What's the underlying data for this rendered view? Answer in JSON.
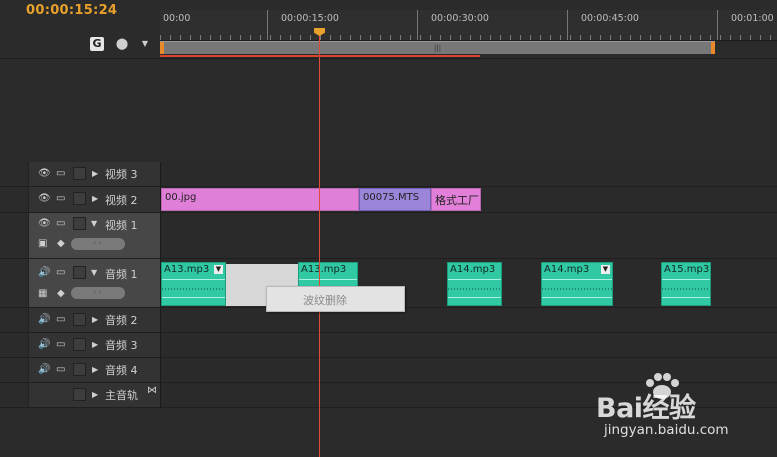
{
  "header": {
    "timecode": "00:00:15:24"
  },
  "ruler": {
    "labels": [
      "00:00",
      "00:00:15:00",
      "00:00:30:00",
      "00:00:45:00",
      "00:01:00"
    ]
  },
  "tracks": {
    "video3": {
      "name": "视频 3"
    },
    "video2": {
      "name": "视频 2"
    },
    "video1": {
      "name": "视频 1"
    },
    "audio1": {
      "name": "音频 1"
    },
    "audio2": {
      "name": "音频 2"
    },
    "audio3": {
      "name": "音频 3"
    },
    "audio4": {
      "name": "音频 4"
    },
    "master": {
      "name": "主音轨"
    }
  },
  "video_clips": [
    {
      "label": "00.jpg"
    },
    {
      "label": "00075.MTS"
    },
    {
      "label": "格式工厂"
    }
  ],
  "audio_clips": [
    {
      "label": "A13.mp3"
    },
    {
      "label": "A13.mp3"
    },
    {
      "label": "A14.mp3"
    },
    {
      "label": "A14.mp3"
    },
    {
      "label": "A15.mp3"
    }
  ],
  "context_menu": {
    "items": [
      {
        "label": "波纹删除",
        "enabled": false
      }
    ]
  },
  "watermark": {
    "brand": "Bai经验",
    "url": "jingyan.baidu.com"
  },
  "colors": {
    "timecode": "#e8a12a",
    "playhead": "#e24b3a",
    "video_clip": "#e07fd8",
    "mts_clip": "#9a85d9",
    "audio_clip": "#31c8a4"
  }
}
